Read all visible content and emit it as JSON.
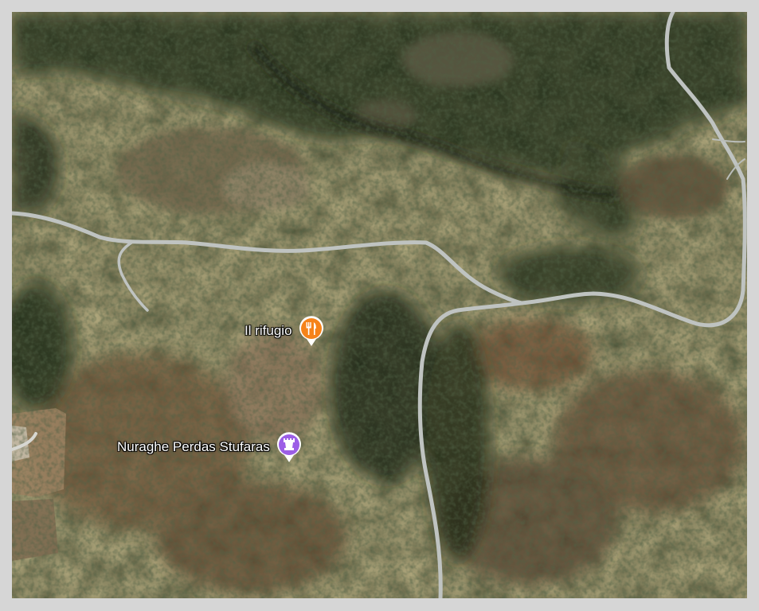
{
  "map": {
    "view": "satellite",
    "places": [
      {
        "name": "Il rifugio",
        "category": "restaurant",
        "icon": "fork-knife-icon",
        "pin_color": "#f6831a"
      },
      {
        "name": "Nuraghe Perdas Stufaras",
        "category": "historical-landmark",
        "icon": "tower-icon",
        "pin_color": "#9c5ee6"
      }
    ],
    "road_color": "#bfc3c1"
  }
}
